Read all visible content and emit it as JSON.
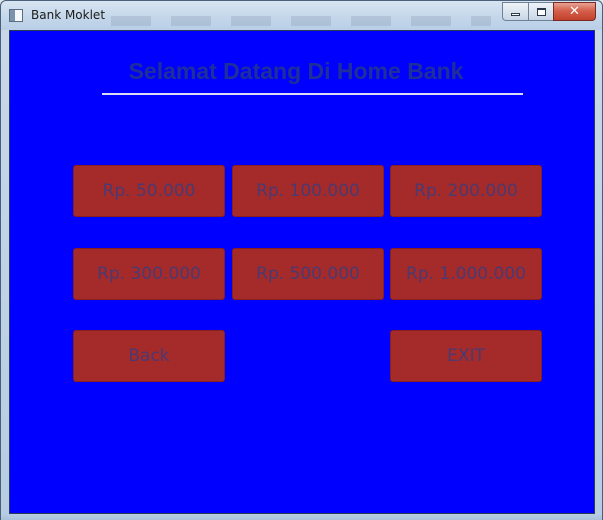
{
  "window": {
    "title": "Bank Moklet",
    "controls": {
      "minimize": "",
      "maximize": "",
      "close": "✕"
    }
  },
  "main": {
    "heading": "Selamat Datang Di Home Bank",
    "amount_buttons": [
      "Rp. 50.000",
      "Rp. 100.000",
      "Rp. 200.000",
      "Rp. 300.000",
      "Rp. 500.000",
      "Rp. 1.000.000"
    ],
    "back_label": "Back",
    "exit_label": "EXIT"
  },
  "colors": {
    "background": "#0000ff",
    "button": "#a52a2a",
    "button_text": "#4a3a72",
    "heading": "#1f2f9a"
  },
  "icons": {
    "app": "window-app-icon",
    "minimize": "minimize-icon",
    "maximize": "maximize-icon",
    "close": "close-icon"
  }
}
